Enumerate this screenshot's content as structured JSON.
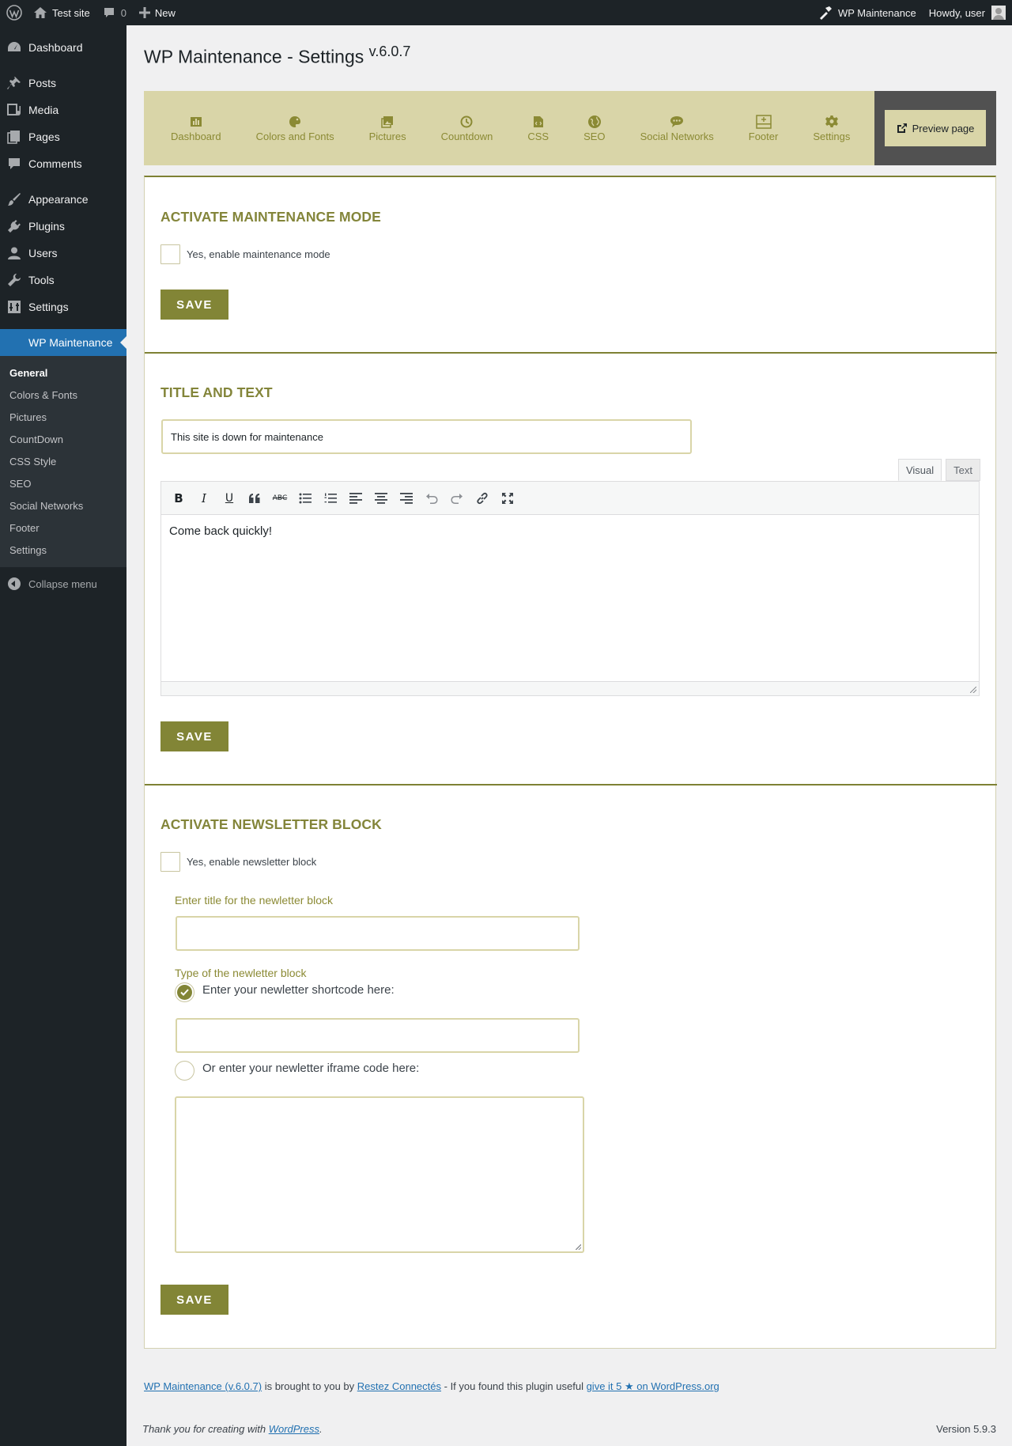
{
  "adminbar": {
    "site_name": "Test site",
    "comments_count": "0",
    "new_label": "New",
    "plugin_label": "WP Maintenance",
    "howdy": "Howdy, user"
  },
  "sidebar": {
    "items": [
      {
        "label": "Dashboard",
        "icon": "dashboard-icon"
      },
      {
        "label": "Posts",
        "icon": "pin-icon"
      },
      {
        "label": "Media",
        "icon": "media-icon"
      },
      {
        "label": "Pages",
        "icon": "pages-icon"
      },
      {
        "label": "Comments",
        "icon": "comment-icon"
      },
      {
        "label": "Appearance",
        "icon": "brush-icon"
      },
      {
        "label": "Plugins",
        "icon": "plug-icon"
      },
      {
        "label": "Users",
        "icon": "user-icon"
      },
      {
        "label": "Tools",
        "icon": "wrench-icon"
      },
      {
        "label": "Settings",
        "icon": "settings-icon"
      }
    ],
    "current": "WP Maintenance",
    "submenu": [
      "General",
      "Colors & Fonts",
      "Pictures",
      "CountDown",
      "CSS Style",
      "SEO",
      "Social Networks",
      "Footer",
      "Settings"
    ],
    "collapse": "Collapse menu"
  },
  "page": {
    "title": "WP Maintenance - Settings",
    "version": "v.6.0.7"
  },
  "tabs": [
    "Dashboard",
    "Colors and Fonts",
    "Pictures",
    "Countdown",
    "CSS",
    "SEO",
    "Social Networks",
    "Footer",
    "Settings"
  ],
  "preview_label": "Preview page",
  "sections": {
    "maintenance": {
      "title": "Activate maintenance mode",
      "checkbox_label": "Yes, enable maintenance mode",
      "save": "SAVE"
    },
    "title_text": {
      "title": "Title and text",
      "title_value": "This site is down for maintenance",
      "tab_visual": "Visual",
      "tab_text": "Text",
      "body": "Come back quickly!",
      "save": "SAVE"
    },
    "newsletter": {
      "title": "Activate newsletter block",
      "checkbox_label": "Yes, enable newsletter block",
      "title_label": "Enter title for the newletter block",
      "title_value": "",
      "type_label": "Type of the newletter block",
      "option_shortcode": "Enter your newletter shortcode here:",
      "shortcode_value": "",
      "option_iframe": "Or enter your newletter iframe code here:",
      "iframe_value": "",
      "save": "SAVE"
    }
  },
  "footer": {
    "plugin_link": "WP Maintenance (v.6.0.7)",
    "brought_by": " is brought to you by ",
    "author_link": "Restez Connectés",
    "useful": " - If you found this plugin useful ",
    "rate_link": "give it 5 ★ on WordPress.org",
    "thanks_prefix": "Thank you for creating with ",
    "wp_link": "WordPress",
    "thanks_suffix": ".",
    "version": "Version 5.9.3"
  }
}
